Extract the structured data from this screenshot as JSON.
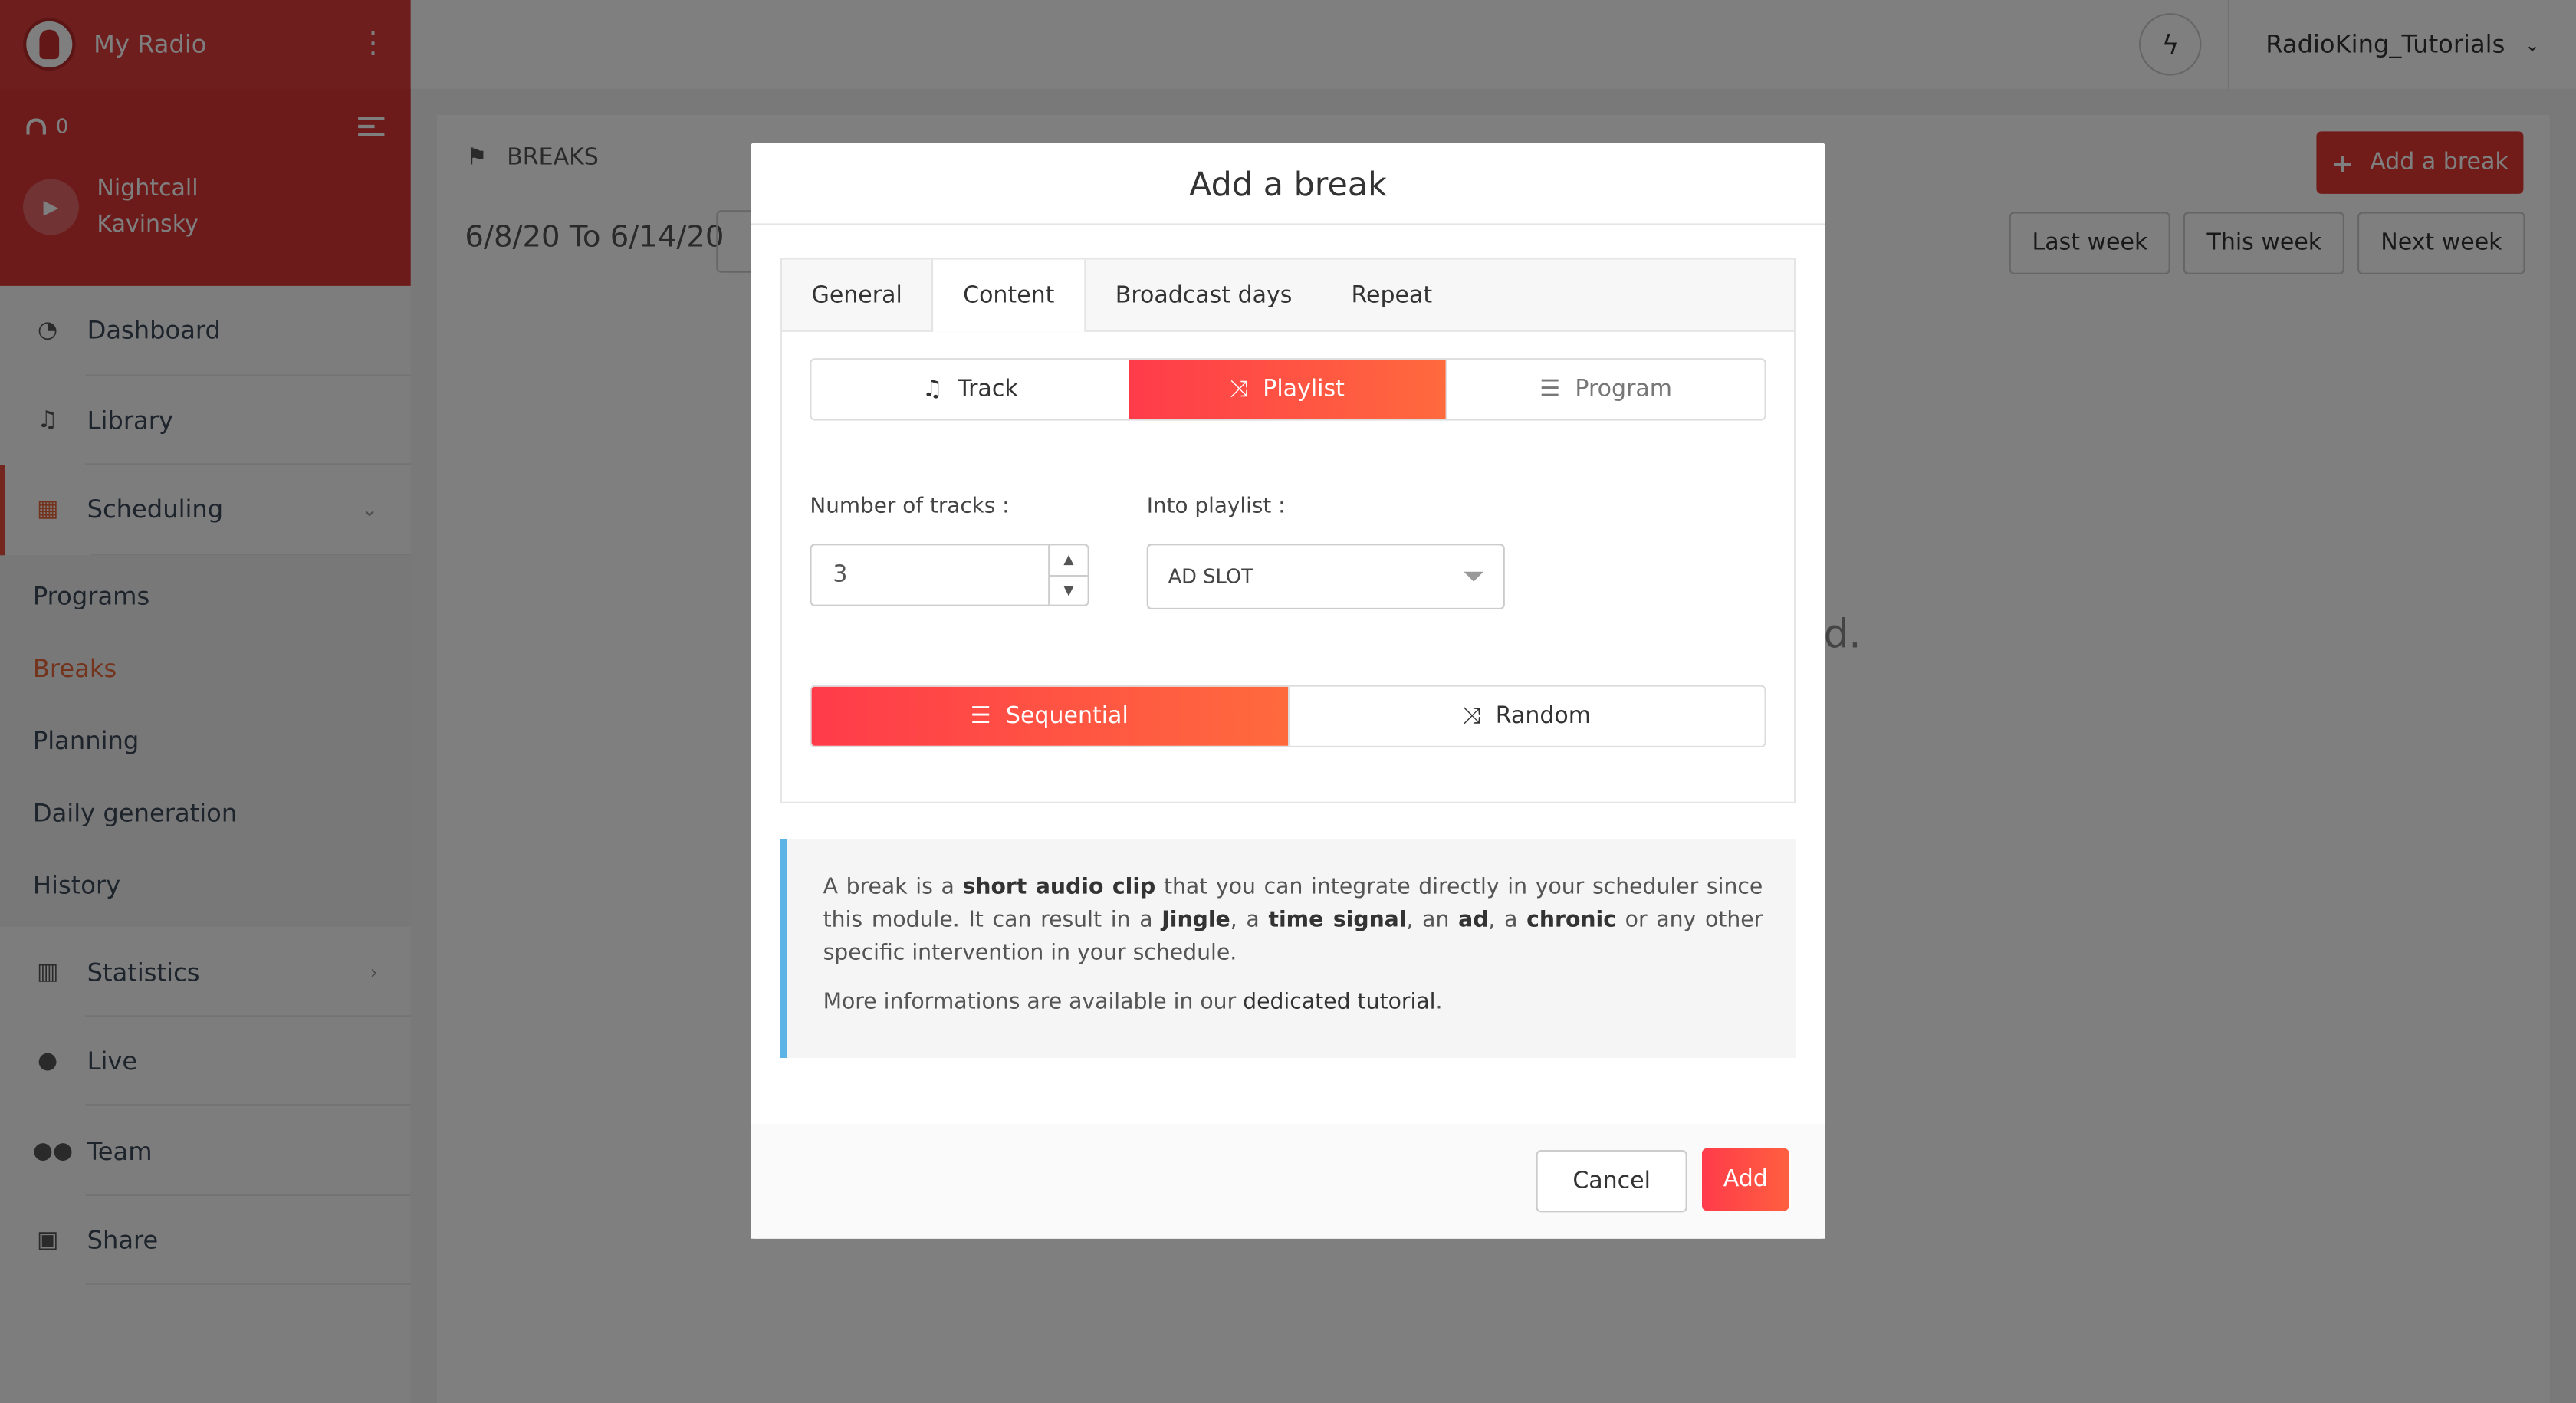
{
  "app": {
    "name": "My Radio",
    "listeners": "0",
    "now_playing": {
      "title": "Nightcall",
      "artist": "Kavinsky"
    }
  },
  "sidebar": {
    "items": [
      {
        "label": "Dashboard",
        "icon": "dashboard-icon"
      },
      {
        "label": "Library",
        "icon": "music-note-icon"
      },
      {
        "label": "Scheduling",
        "icon": "calendar-icon"
      },
      {
        "label": "Statistics",
        "icon": "bar-chart-icon"
      },
      {
        "label": "Live",
        "icon": "microphone-icon"
      },
      {
        "label": "Team",
        "icon": "users-icon"
      },
      {
        "label": "Share",
        "icon": "share-icon"
      }
    ],
    "scheduling_sub": [
      {
        "label": "Programs"
      },
      {
        "label": "Breaks"
      },
      {
        "label": "Planning"
      },
      {
        "label": "Daily generation"
      },
      {
        "label": "History"
      }
    ]
  },
  "topbar": {
    "user": "RadioKing_Tutorials"
  },
  "page": {
    "breadcrumb": "BREAKS",
    "date_range": "6/8/20 To 6/14/20",
    "add_break_label": "Add a break",
    "weeks": {
      "last": "Last week",
      "this": "This week",
      "next": "Next week"
    },
    "background_fragment": "d."
  },
  "modal": {
    "title": "Add a break",
    "tabs": [
      "General",
      "Content",
      "Broadcast days",
      "Repeat"
    ],
    "content_types": {
      "track": "Track",
      "playlist": "Playlist",
      "program": "Program"
    },
    "number_of_tracks_label": "Number of tracks :",
    "number_of_tracks_value": "3",
    "into_playlist_label": "Into playlist :",
    "into_playlist_value": "AD SLOT",
    "order": {
      "sequential": "Sequential",
      "random": "Random"
    },
    "info": {
      "p1": [
        "A break is a ",
        "short audio clip",
        " that you can integrate directly in your scheduler since this module. It can result in a ",
        "Jingle",
        ", a ",
        "time signal",
        ", an ",
        "ad",
        ", a ",
        "chronic",
        " or any other specific intervention in your schedule."
      ],
      "p2": [
        "More informations are available in our ",
        "dedicated tutorial",
        "."
      ]
    },
    "cancel_label": "Cancel",
    "add_label": "Add"
  },
  "colors": {
    "brand_red": "#d93535",
    "accent_orange": "#ff6a3d",
    "info_border": "#5cb3e6"
  }
}
